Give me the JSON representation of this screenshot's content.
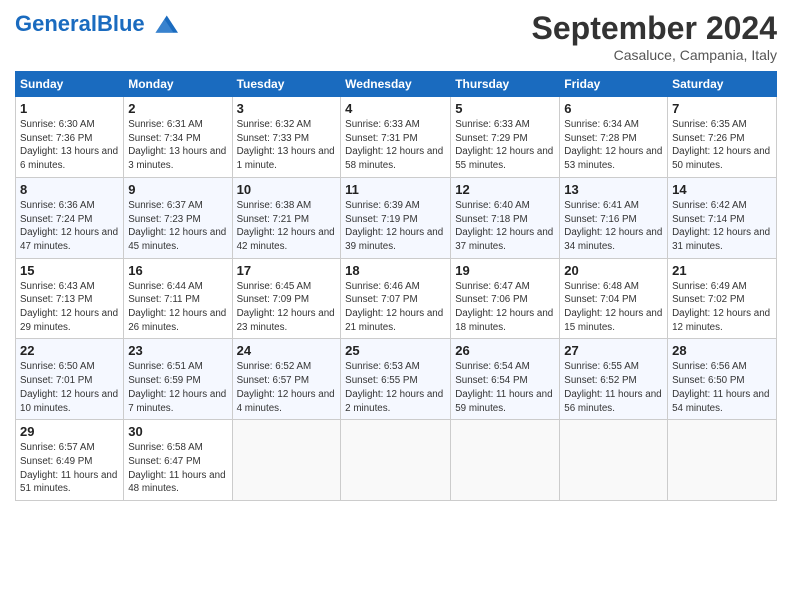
{
  "header": {
    "logo_general": "General",
    "logo_blue": "Blue",
    "title": "September 2024",
    "location": "Casaluce, Campania, Italy"
  },
  "columns": [
    "Sunday",
    "Monday",
    "Tuesday",
    "Wednesday",
    "Thursday",
    "Friday",
    "Saturday"
  ],
  "weeks": [
    [
      {
        "day": "1",
        "sunrise": "Sunrise: 6:30 AM",
        "sunset": "Sunset: 7:36 PM",
        "daylight": "Daylight: 13 hours and 6 minutes."
      },
      {
        "day": "2",
        "sunrise": "Sunrise: 6:31 AM",
        "sunset": "Sunset: 7:34 PM",
        "daylight": "Daylight: 13 hours and 3 minutes."
      },
      {
        "day": "3",
        "sunrise": "Sunrise: 6:32 AM",
        "sunset": "Sunset: 7:33 PM",
        "daylight": "Daylight: 13 hours and 1 minute."
      },
      {
        "day": "4",
        "sunrise": "Sunrise: 6:33 AM",
        "sunset": "Sunset: 7:31 PM",
        "daylight": "Daylight: 12 hours and 58 minutes."
      },
      {
        "day": "5",
        "sunrise": "Sunrise: 6:33 AM",
        "sunset": "Sunset: 7:29 PM",
        "daylight": "Daylight: 12 hours and 55 minutes."
      },
      {
        "day": "6",
        "sunrise": "Sunrise: 6:34 AM",
        "sunset": "Sunset: 7:28 PM",
        "daylight": "Daylight: 12 hours and 53 minutes."
      },
      {
        "day": "7",
        "sunrise": "Sunrise: 6:35 AM",
        "sunset": "Sunset: 7:26 PM",
        "daylight": "Daylight: 12 hours and 50 minutes."
      }
    ],
    [
      {
        "day": "8",
        "sunrise": "Sunrise: 6:36 AM",
        "sunset": "Sunset: 7:24 PM",
        "daylight": "Daylight: 12 hours and 47 minutes."
      },
      {
        "day": "9",
        "sunrise": "Sunrise: 6:37 AM",
        "sunset": "Sunset: 7:23 PM",
        "daylight": "Daylight: 12 hours and 45 minutes."
      },
      {
        "day": "10",
        "sunrise": "Sunrise: 6:38 AM",
        "sunset": "Sunset: 7:21 PM",
        "daylight": "Daylight: 12 hours and 42 minutes."
      },
      {
        "day": "11",
        "sunrise": "Sunrise: 6:39 AM",
        "sunset": "Sunset: 7:19 PM",
        "daylight": "Daylight: 12 hours and 39 minutes."
      },
      {
        "day": "12",
        "sunrise": "Sunrise: 6:40 AM",
        "sunset": "Sunset: 7:18 PM",
        "daylight": "Daylight: 12 hours and 37 minutes."
      },
      {
        "day": "13",
        "sunrise": "Sunrise: 6:41 AM",
        "sunset": "Sunset: 7:16 PM",
        "daylight": "Daylight: 12 hours and 34 minutes."
      },
      {
        "day": "14",
        "sunrise": "Sunrise: 6:42 AM",
        "sunset": "Sunset: 7:14 PM",
        "daylight": "Daylight: 12 hours and 31 minutes."
      }
    ],
    [
      {
        "day": "15",
        "sunrise": "Sunrise: 6:43 AM",
        "sunset": "Sunset: 7:13 PM",
        "daylight": "Daylight: 12 hours and 29 minutes."
      },
      {
        "day": "16",
        "sunrise": "Sunrise: 6:44 AM",
        "sunset": "Sunset: 7:11 PM",
        "daylight": "Daylight: 12 hours and 26 minutes."
      },
      {
        "day": "17",
        "sunrise": "Sunrise: 6:45 AM",
        "sunset": "Sunset: 7:09 PM",
        "daylight": "Daylight: 12 hours and 23 minutes."
      },
      {
        "day": "18",
        "sunrise": "Sunrise: 6:46 AM",
        "sunset": "Sunset: 7:07 PM",
        "daylight": "Daylight: 12 hours and 21 minutes."
      },
      {
        "day": "19",
        "sunrise": "Sunrise: 6:47 AM",
        "sunset": "Sunset: 7:06 PM",
        "daylight": "Daylight: 12 hours and 18 minutes."
      },
      {
        "day": "20",
        "sunrise": "Sunrise: 6:48 AM",
        "sunset": "Sunset: 7:04 PM",
        "daylight": "Daylight: 12 hours and 15 minutes."
      },
      {
        "day": "21",
        "sunrise": "Sunrise: 6:49 AM",
        "sunset": "Sunset: 7:02 PM",
        "daylight": "Daylight: 12 hours and 12 minutes."
      }
    ],
    [
      {
        "day": "22",
        "sunrise": "Sunrise: 6:50 AM",
        "sunset": "Sunset: 7:01 PM",
        "daylight": "Daylight: 12 hours and 10 minutes."
      },
      {
        "day": "23",
        "sunrise": "Sunrise: 6:51 AM",
        "sunset": "Sunset: 6:59 PM",
        "daylight": "Daylight: 12 hours and 7 minutes."
      },
      {
        "day": "24",
        "sunrise": "Sunrise: 6:52 AM",
        "sunset": "Sunset: 6:57 PM",
        "daylight": "Daylight: 12 hours and 4 minutes."
      },
      {
        "day": "25",
        "sunrise": "Sunrise: 6:53 AM",
        "sunset": "Sunset: 6:55 PM",
        "daylight": "Daylight: 12 hours and 2 minutes."
      },
      {
        "day": "26",
        "sunrise": "Sunrise: 6:54 AM",
        "sunset": "Sunset: 6:54 PM",
        "daylight": "Daylight: 11 hours and 59 minutes."
      },
      {
        "day": "27",
        "sunrise": "Sunrise: 6:55 AM",
        "sunset": "Sunset: 6:52 PM",
        "daylight": "Daylight: 11 hours and 56 minutes."
      },
      {
        "day": "28",
        "sunrise": "Sunrise: 6:56 AM",
        "sunset": "Sunset: 6:50 PM",
        "daylight": "Daylight: 11 hours and 54 minutes."
      }
    ],
    [
      {
        "day": "29",
        "sunrise": "Sunrise: 6:57 AM",
        "sunset": "Sunset: 6:49 PM",
        "daylight": "Daylight: 11 hours and 51 minutes."
      },
      {
        "day": "30",
        "sunrise": "Sunrise: 6:58 AM",
        "sunset": "Sunset: 6:47 PM",
        "daylight": "Daylight: 11 hours and 48 minutes."
      },
      null,
      null,
      null,
      null,
      null
    ]
  ]
}
